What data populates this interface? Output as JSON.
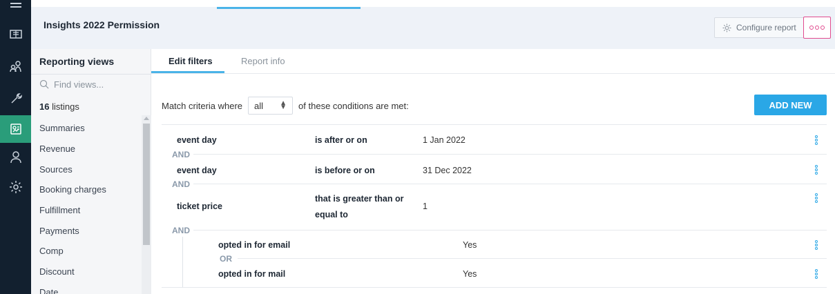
{
  "rail": {
    "icons": [
      "menu-icon",
      "ticket-icon",
      "users-icon",
      "wrench-icon",
      "report-icon",
      "person-icon",
      "gear-icon"
    ]
  },
  "header": {
    "title": "Insights 2022 Permission",
    "configure_label": "Configure report"
  },
  "views": {
    "title": "Reporting views",
    "search_placeholder": "Find views...",
    "listings_count": "16",
    "listings_label": "listings",
    "items": [
      "Summaries",
      "Revenue",
      "Sources",
      "Booking charges",
      "Fulfillment",
      "Payments",
      "Comp",
      "Discount",
      "Date"
    ]
  },
  "tabs": [
    {
      "label": "Edit filters",
      "active": true
    },
    {
      "label": "Report info",
      "active": false
    }
  ],
  "match": {
    "prefix": "Match criteria where",
    "selected": "all",
    "suffix": "of these conditions are met:",
    "add_new_label": "ADD NEW"
  },
  "conditions": [
    {
      "field": "event day",
      "operator": "is after or on",
      "value": "1 Jan 2022"
    },
    {
      "field": "event day",
      "operator": "is before or on",
      "value": "31 Dec 2022"
    },
    {
      "field": "ticket price",
      "operator_line1": "that is greater than or",
      "operator_line2": "equal to",
      "value": "1"
    }
  ],
  "joiners": {
    "and": "AND",
    "or": "OR"
  },
  "group": [
    {
      "field": "opted in for email",
      "value": "Yes"
    },
    {
      "field": "opted in for mail",
      "value": "Yes"
    }
  ],
  "colors": {
    "accent": "#2aa7e6",
    "rail_bg": "#12202f",
    "rail_active": "#2a9d7a",
    "more_border": "#e14a8e"
  }
}
